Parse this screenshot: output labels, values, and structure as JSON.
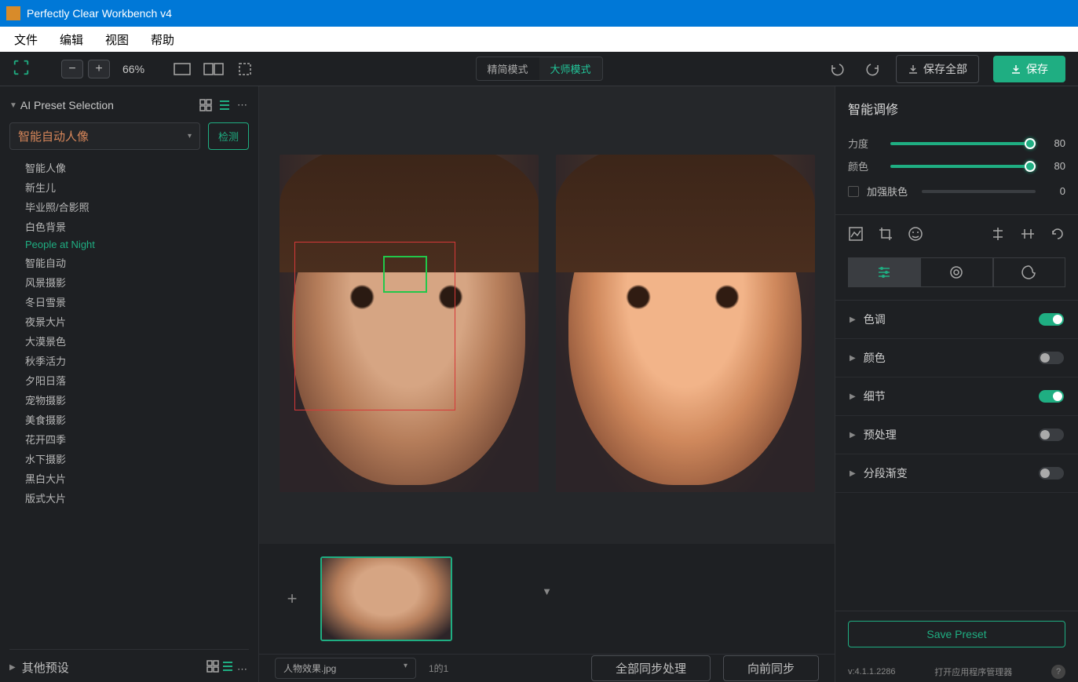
{
  "titlebar": {
    "title": "Perfectly Clear Workbench v4"
  },
  "menubar": {
    "file": "文件",
    "edit": "编辑",
    "view": "视图",
    "help": "帮助"
  },
  "toolbar": {
    "zoom": "66%",
    "mode_simple": "精简模式",
    "mode_master": "大师模式",
    "save_all": "保存全部",
    "save": "保存"
  },
  "left": {
    "title": "AI Preset Selection",
    "selected_preset": "智能自动人像",
    "detect": "检测",
    "presets": [
      {
        "label": "智能人像",
        "sel": false
      },
      {
        "label": "新生儿",
        "sel": false
      },
      {
        "label": "毕业照/合影照",
        "sel": false
      },
      {
        "label": "白色背景",
        "sel": false
      },
      {
        "label": "People at Night",
        "sel": true
      },
      {
        "label": "智能自动",
        "sel": false
      },
      {
        "label": "风景摄影",
        "sel": false
      },
      {
        "label": "冬日雪景",
        "sel": false
      },
      {
        "label": "夜景大片",
        "sel": false
      },
      {
        "label": "大漠景色",
        "sel": false
      },
      {
        "label": "秋季活力",
        "sel": false
      },
      {
        "label": "夕阳日落",
        "sel": false
      },
      {
        "label": "宠物摄影",
        "sel": false
      },
      {
        "label": "美食摄影",
        "sel": false
      },
      {
        "label": "花开四季",
        "sel": false
      },
      {
        "label": "水下摄影",
        "sel": false
      },
      {
        "label": "黑白大片",
        "sel": false
      },
      {
        "label": "版式大片",
        "sel": false
      }
    ],
    "other_presets": "其他预设"
  },
  "filmstrip": {
    "filename": "人物效果.jpg",
    "page": "1的1"
  },
  "bottombar": {
    "sync_all": "全部同步处理",
    "sync_fwd": "向前同步"
  },
  "right": {
    "title": "智能调修",
    "sliders": [
      {
        "label": "力度",
        "value": 80,
        "on": true
      },
      {
        "label": "颜色",
        "value": 80,
        "on": true
      }
    ],
    "enhance_skin": "加强肤色",
    "enhance_skin_value": 0,
    "accordion": [
      {
        "label": "色调",
        "on": true
      },
      {
        "label": "颜色",
        "on": false
      },
      {
        "label": "细节",
        "on": true
      },
      {
        "label": "预处理",
        "on": false
      },
      {
        "label": "分段渐变",
        "on": false
      }
    ],
    "save_preset": "Save Preset",
    "version": "v:4.1.1.2286",
    "manage_link": "打开应用程序管理器"
  }
}
